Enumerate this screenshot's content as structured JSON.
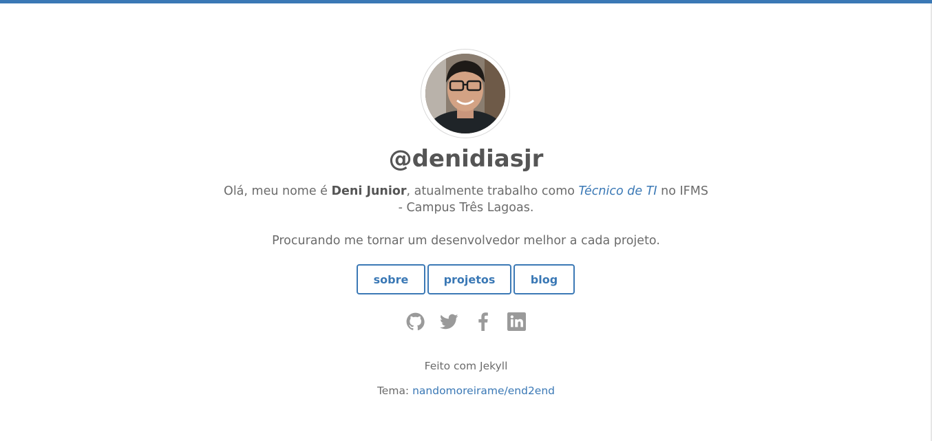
{
  "profile": {
    "handle": "@denidiasjr",
    "avatar_alt": "avatar"
  },
  "bio": {
    "prefix": "Olá, meu nome é ",
    "name": "Deni Junior",
    "middle": ", atualmente trabalho como ",
    "role": "Técnico de TI",
    "suffix_line1": " no IFMS",
    "suffix_line2": "- Campus Três Lagoas."
  },
  "tagline": "Procurando me tornar um desenvolvedor melhor a cada projeto.",
  "nav": {
    "items": [
      {
        "label": "sobre"
      },
      {
        "label": "projetos"
      },
      {
        "label": "blog"
      }
    ]
  },
  "social": {
    "icons": [
      "github-icon",
      "twitter-icon",
      "facebook-icon",
      "linkedin-icon"
    ],
    "icon_color": "#9a9a9a"
  },
  "footer": {
    "made_with": "Feito com Jekyll",
    "theme_prefix": "Tema: ",
    "theme_link": "nandomoreirame/end2end"
  },
  "colors": {
    "accent": "#3a78b5",
    "text": "#6b6b6b",
    "heading": "#555555"
  }
}
